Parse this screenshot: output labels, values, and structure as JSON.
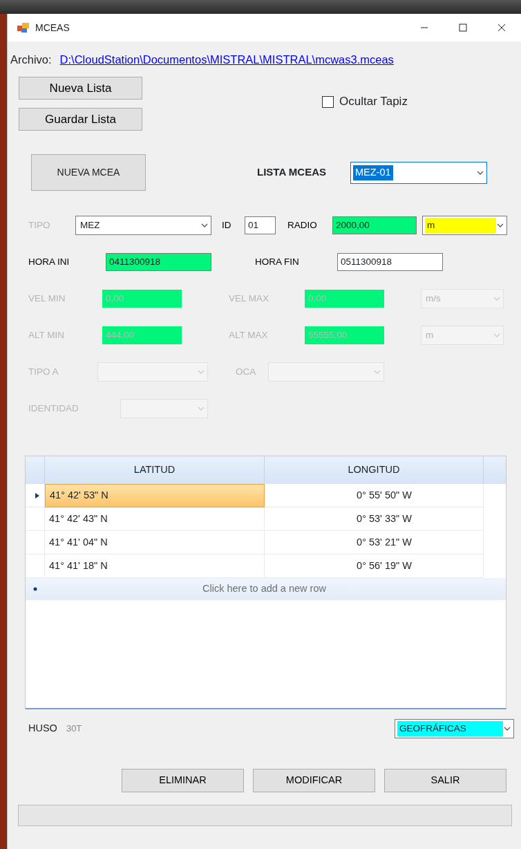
{
  "window": {
    "title": "MCEAS"
  },
  "file": {
    "label": "Archivo:",
    "path": "D:\\CloudStation\\Documentos\\MISTRAL\\MISTRAL\\mcwas3.mceas"
  },
  "list_buttons": [
    {
      "label": "Nueva Lista"
    },
    {
      "label": "Guardar Lista"
    }
  ],
  "hide_wallpaper": {
    "label": "Ocultar Tapiz",
    "checked": false
  },
  "new_button": {
    "label": "NUEVA MCEA"
  },
  "list_selector": {
    "label": "LISTA MCEAS",
    "value": "MEZ-01",
    "text_selected": true
  },
  "form_rows": [
    [
      {
        "kind": "label",
        "text": "TIPO",
        "disabled": true
      },
      {
        "kind": "select",
        "value": "MEZ",
        "disabled": false
      },
      {
        "kind": "label",
        "text": "ID",
        "disabled": false
      },
      {
        "kind": "input",
        "value": "01",
        "disabled": false
      },
      {
        "kind": "label",
        "text": "RADIO",
        "disabled": false
      },
      {
        "kind": "input",
        "value": "2000,00",
        "disabled": false,
        "color": "#00f57a"
      },
      {
        "kind": "select",
        "value": "m",
        "disabled": false,
        "color": "#ffff00"
      }
    ],
    [
      {
        "kind": "label",
        "text": "HORA INI",
        "disabled": false
      },
      {
        "kind": "input",
        "value": "0411300918",
        "disabled": false,
        "color": "#00f57a"
      },
      {
        "kind": "label",
        "text": "HORA FIN",
        "disabled": false
      },
      {
        "kind": "input",
        "value": "0511300918",
        "disabled": false
      }
    ],
    [
      {
        "kind": "label",
        "text": "VEL MIN",
        "disabled": true
      },
      {
        "kind": "input",
        "value": "0,00",
        "disabled": true,
        "color": "#00f57a"
      },
      {
        "kind": "label",
        "text": "VEL MAX",
        "disabled": true
      },
      {
        "kind": "input",
        "value": "0,00",
        "disabled": true,
        "color": "#00f57a"
      },
      {
        "kind": "select",
        "value": "m/s",
        "disabled": true
      }
    ],
    [
      {
        "kind": "label",
        "text": "ALT MIN",
        "disabled": true
      },
      {
        "kind": "input",
        "value": "444,00",
        "disabled": true,
        "color": "#00f57a"
      },
      {
        "kind": "label",
        "text": "ALT MAX",
        "disabled": true
      },
      {
        "kind": "input",
        "value": "55555,00",
        "disabled": true,
        "color": "#00f57a"
      },
      {
        "kind": "select",
        "value": "m",
        "disabled": true
      }
    ],
    [
      {
        "kind": "label",
        "text": "TIPO A",
        "disabled": true
      },
      {
        "kind": "select",
        "disabled": true
      },
      {
        "kind": "label",
        "text": "OCA",
        "disabled": true
      },
      {
        "kind": "select",
        "disabled": true
      }
    ],
    [
      {
        "kind": "label",
        "text": "IDENTIDAD",
        "disabled": true
      },
      {
        "kind": "select",
        "disabled": true
      }
    ]
  ],
  "grid": {
    "columns": [
      "LATITUD",
      "LONGITUD"
    ],
    "rows": [
      {
        "cells": [
          "41° 42' 53\" N",
          "0° 55' 50\" W"
        ],
        "selected": true
      },
      {
        "cells": [
          "41° 42' 43\" N",
          "0° 53' 33\" W"
        ],
        "selected": false
      },
      {
        "cells": [
          "41° 41' 04\" N",
          "0° 53' 21\" W"
        ],
        "selected": false
      },
      {
        "cells": [
          "41° 41' 18\" N",
          "0° 56' 19\" W"
        ],
        "selected": false
      }
    ],
    "new_row": "Click here to add a new row"
  },
  "huso": {
    "label": "HUSO",
    "value": "30T"
  },
  "coord_select": {
    "value": "GEOFRÁFICAS",
    "color": "#00ffff"
  },
  "actions": [
    {
      "label": "ELIMINAR"
    },
    {
      "label": "MODIFICAR"
    },
    {
      "label": "SALIR"
    }
  ]
}
